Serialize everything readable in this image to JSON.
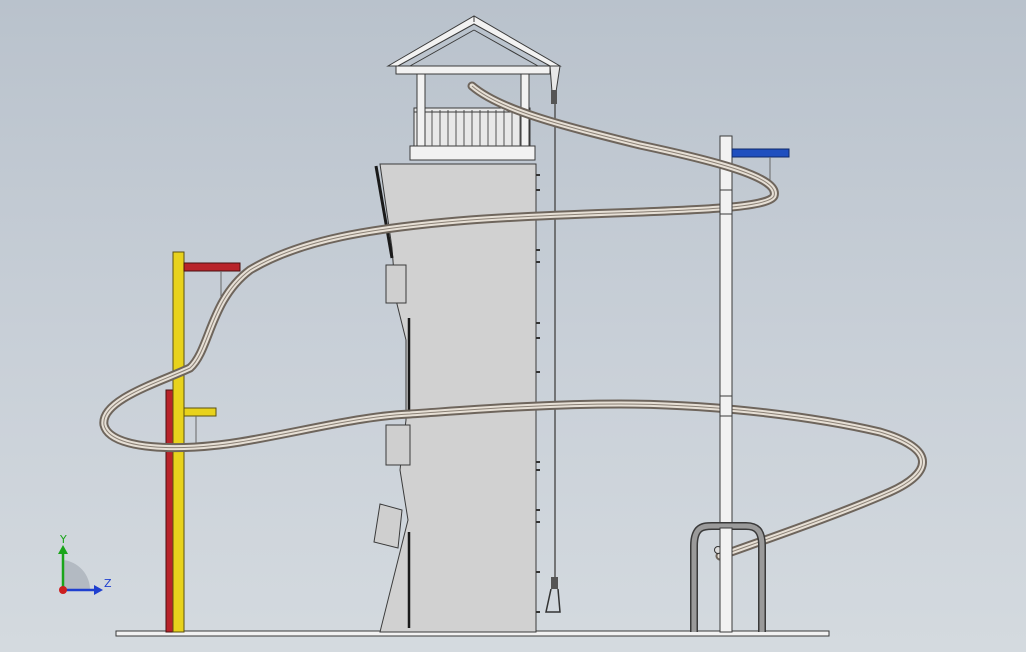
{
  "viewport": {
    "background_top": "#b9c2cc",
    "background_bottom": "#d4dadf"
  },
  "colors": {
    "tower_fill": "#cfcfcf",
    "tower_edge": "#3a3a3a",
    "slide_outer": "#6e655c",
    "slide_inner": "#e6dfd5",
    "post_yellow": "#e8d21c",
    "post_red": "#b8232a",
    "post_white": "#f2f2f2",
    "bar_blue": "#1f4fbf",
    "ground": "#f2f2f2",
    "rope": "#555555",
    "axis_y": "#1aa51a",
    "axis_z": "#1f3fcf",
    "axis_origin": "#cc1f1f"
  },
  "triad": {
    "y_label": "Y",
    "z_label": "Z"
  },
  "icons": {
    "coordinate_triad": "xyz-triad-icon"
  }
}
